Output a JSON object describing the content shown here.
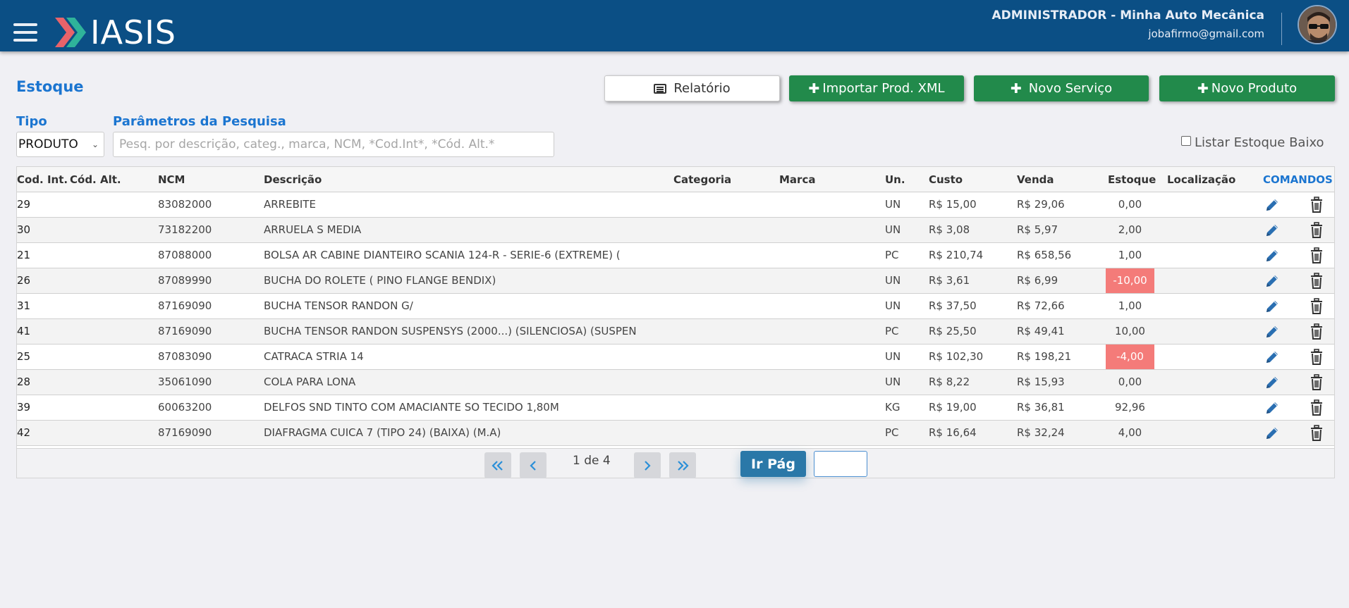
{
  "header": {
    "logo_text": "IASIS",
    "user_title": "ADMINISTRADOR - Minha Auto Mecânica",
    "user_email": "jobafirmo@gmail.com"
  },
  "page": {
    "title": "Estoque"
  },
  "buttons": {
    "report": "Relatório",
    "import_xml": "Importar Prod. XML",
    "new_service": "Novo Serviço",
    "new_product": "Novo Produto"
  },
  "filters": {
    "type_label": "Tipo",
    "type_value": "PRODUTO",
    "search_label": "Parâmetros da Pesquisa",
    "search_placeholder": "Pesq. por descrição, categ., marca, NCM, *Cod.Int*, *Cód. Alt.*",
    "low_stock_label": "Listar Estoque Baixo"
  },
  "table": {
    "columns": [
      "Cod. Int.",
      "Cód. Alt.",
      "NCM",
      "Descrição",
      "Categoria",
      "Marca",
      "Un.",
      "Custo",
      "Venda",
      "Estoque",
      "Localização",
      "COMANDOS"
    ],
    "rows": [
      {
        "cod": "29",
        "alt": "",
        "ncm": "83082000",
        "desc": "ARREBITE",
        "cat": "",
        "marca": "",
        "un": "UN",
        "custo": "R$ 15,00",
        "venda": "R$ 29,06",
        "estoque": "0,00",
        "loc": "",
        "negative": false
      },
      {
        "cod": "30",
        "alt": "",
        "ncm": "73182200",
        "desc": "ARRUELA S MEDIA",
        "cat": "",
        "marca": "",
        "un": "UN",
        "custo": "R$ 3,08",
        "venda": "R$ 5,97",
        "estoque": "2,00",
        "loc": "",
        "negative": false
      },
      {
        "cod": "21",
        "alt": "",
        "ncm": "87088000",
        "desc": "BOLSA AR CABINE DIANTEIRO SCANIA 124-R - SERIE-6 (EXTREME) (",
        "cat": "",
        "marca": "",
        "un": "PC",
        "custo": "R$ 210,74",
        "venda": "R$ 658,56",
        "estoque": "1,00",
        "loc": "",
        "negative": false
      },
      {
        "cod": "26",
        "alt": "",
        "ncm": "87089990",
        "desc": "BUCHA DO ROLETE ( PINO FLANGE BENDIX)",
        "cat": "",
        "marca": "",
        "un": "UN",
        "custo": "R$ 3,61",
        "venda": "R$ 6,99",
        "estoque": "-10,00",
        "loc": "",
        "negative": true
      },
      {
        "cod": "31",
        "alt": "",
        "ncm": "87169090",
        "desc": "BUCHA TENSOR RANDON G/",
        "cat": "",
        "marca": "",
        "un": "UN",
        "custo": "R$ 37,50",
        "venda": "R$ 72,66",
        "estoque": "1,00",
        "loc": "",
        "negative": false
      },
      {
        "cod": "41",
        "alt": "",
        "ncm": "87169090",
        "desc": "BUCHA TENSOR RANDON SUSPENSYS (2000...) (SILENCIOSA) (SUSPEN",
        "cat": "",
        "marca": "",
        "un": "PC",
        "custo": "R$ 25,50",
        "venda": "R$ 49,41",
        "estoque": "10,00",
        "loc": "",
        "negative": false
      },
      {
        "cod": "25",
        "alt": "",
        "ncm": "87083090",
        "desc": "CATRACA STRIA 14",
        "cat": "",
        "marca": "",
        "un": "UN",
        "custo": "R$ 102,30",
        "venda": "R$ 198,21",
        "estoque": "-4,00",
        "loc": "",
        "negative": true
      },
      {
        "cod": "28",
        "alt": "",
        "ncm": "35061090",
        "desc": "COLA PARA LONA",
        "cat": "",
        "marca": "",
        "un": "UN",
        "custo": "R$ 8,22",
        "venda": "R$ 15,93",
        "estoque": "0,00",
        "loc": "",
        "negative": false
      },
      {
        "cod": "39",
        "alt": "",
        "ncm": "60063200",
        "desc": "DELFOS SND TINTO COM AMACIANTE SO TECIDO 1,80M",
        "cat": "",
        "marca": "",
        "un": "KG",
        "custo": "R$ 19,00",
        "venda": "R$ 36,81",
        "estoque": "92,96",
        "loc": "",
        "negative": false
      },
      {
        "cod": "42",
        "alt": "",
        "ncm": "87169090",
        "desc": "DIAFRAGMA CUICA 7  (TIPO 24) (BAIXA) (M.A)",
        "cat": "",
        "marca": "",
        "un": "PC",
        "custo": "R$ 16,64",
        "venda": "R$ 32,24",
        "estoque": "4,00",
        "loc": "",
        "negative": false
      }
    ]
  },
  "pagination": {
    "info": "1 de 4",
    "goto_label": "Ir Pág",
    "goto_value": ""
  },
  "icons": {
    "menu": "hamburger-menu-icon",
    "report": "list-document-icon",
    "add": "plus-icon",
    "edit": "pencil-icon",
    "delete": "trash-icon",
    "first": "double-chevron-left-icon",
    "prev": "chevron-left-icon",
    "next": "chevron-right-icon",
    "last": "double-chevron-right-icon"
  },
  "colors": {
    "header_bg": "#0b4f85",
    "accent_blue": "#1b75d0",
    "green_button": "#228a4b",
    "negative_stock": "#f47b79",
    "edit_icon": "#2a6fb2"
  }
}
